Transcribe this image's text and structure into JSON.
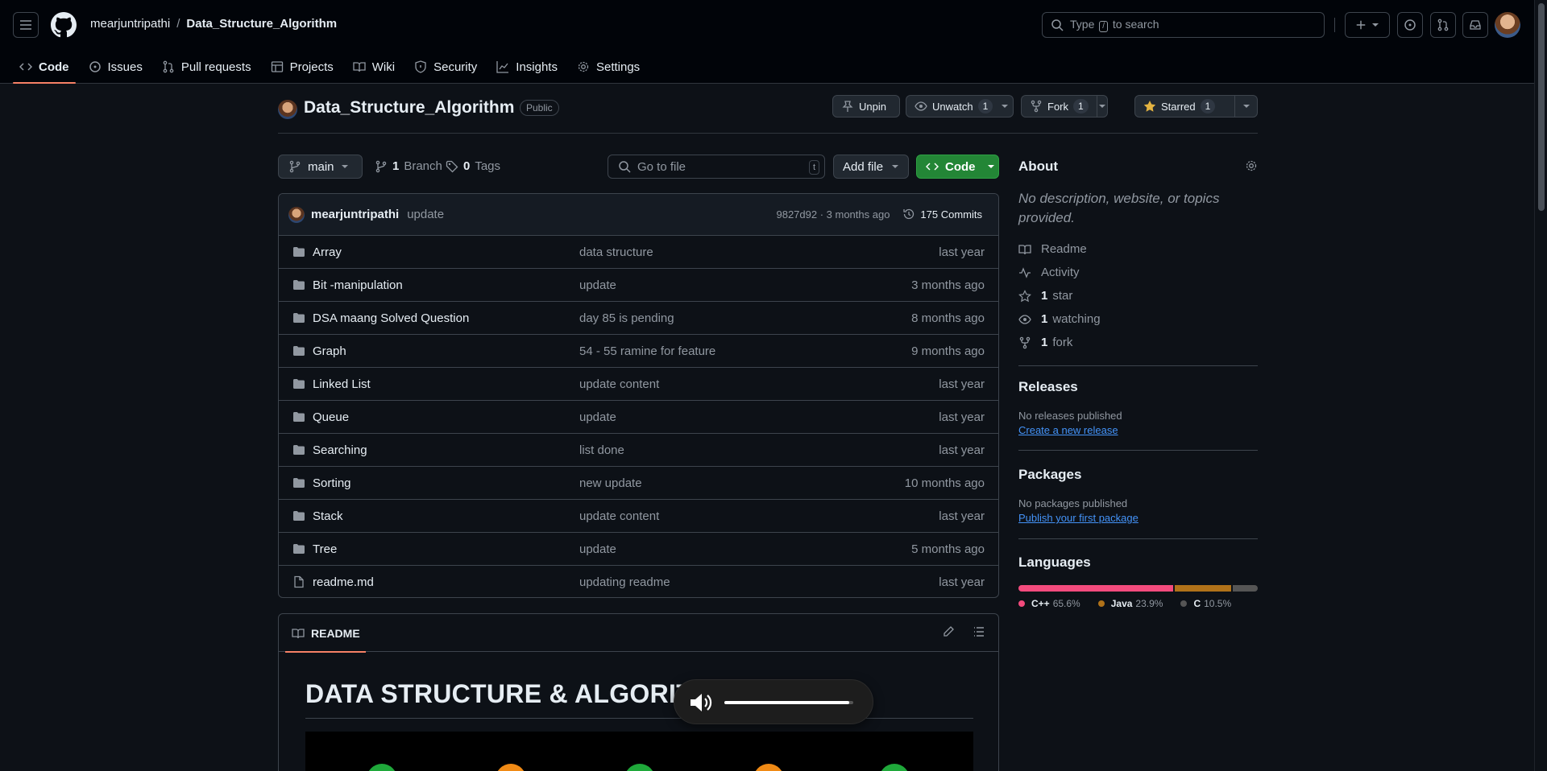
{
  "header": {
    "owner": "mearjuntripathi",
    "slash": "/",
    "repo": "Data_Structure_Algorithm",
    "search_prefix": "Type",
    "search_key": "/",
    "search_suffix": "to search"
  },
  "tabs": [
    {
      "label": "Code",
      "icon": "code-icon"
    },
    {
      "label": "Issues",
      "icon": "issue-icon"
    },
    {
      "label": "Pull requests",
      "icon": "pull-request-icon"
    },
    {
      "label": "Projects",
      "icon": "table-icon"
    },
    {
      "label": "Wiki",
      "icon": "book-icon"
    },
    {
      "label": "Security",
      "icon": "shield-icon"
    },
    {
      "label": "Insights",
      "icon": "graph-icon"
    },
    {
      "label": "Settings",
      "icon": "gear-icon"
    }
  ],
  "repo_header": {
    "title": "Data_Structure_Algorithm",
    "visibility": "Public",
    "unpin": "Unpin",
    "unwatch": "Unwatch",
    "watch_count": "1",
    "fork": "Fork",
    "fork_count": "1",
    "starred": "Starred",
    "star_count": "1"
  },
  "branch": {
    "name": "main",
    "branch_count": "1",
    "branch_label": "Branch",
    "tag_count": "0",
    "tag_label": "Tags",
    "goto_placeholder": "Go to file",
    "goto_key": "t",
    "add_file": "Add file",
    "code": "Code"
  },
  "commit": {
    "user": "mearjuntripathi",
    "message": "update",
    "meta": "9827d92 · 3 months ago",
    "commits": "175 Commits"
  },
  "files": [
    {
      "type": "dir",
      "name": "Array",
      "msg": "data structure",
      "age": "last year"
    },
    {
      "type": "dir",
      "name": "Bit -manipulation",
      "msg": "update",
      "age": "3 months ago"
    },
    {
      "type": "dir",
      "name": "DSA maang Solved Question",
      "msg": "day 85 is pending",
      "age": "8 months ago"
    },
    {
      "type": "dir",
      "name": "Graph",
      "msg": "54 - 55 ramine for feature",
      "age": "9 months ago"
    },
    {
      "type": "dir",
      "name": "Linked List",
      "msg": "update content",
      "age": "last year"
    },
    {
      "type": "dir",
      "name": "Queue",
      "msg": "update",
      "age": "last year"
    },
    {
      "type": "dir",
      "name": "Searching",
      "msg": "list done",
      "age": "last year"
    },
    {
      "type": "dir",
      "name": "Sorting",
      "msg": "new update",
      "age": "10 months ago"
    },
    {
      "type": "dir",
      "name": "Stack",
      "msg": "update content",
      "age": "last year"
    },
    {
      "type": "dir",
      "name": "Tree",
      "msg": "update",
      "age": "5 months ago"
    },
    {
      "type": "file",
      "name": "readme.md",
      "msg": "updating readme",
      "age": "last year"
    }
  ],
  "readme": {
    "tab": "README",
    "title": "DATA STRUCTURE & ALGORITH"
  },
  "about": {
    "heading": "About",
    "description": "No description, website, or topics provided.",
    "readme": "Readme",
    "activity": "Activity",
    "stars_n": "1",
    "stars": "star",
    "watching_n": "1",
    "watching": "watching",
    "forks_n": "1",
    "forks": "fork"
  },
  "releases": {
    "heading": "Releases",
    "none": "No releases published",
    "create": "Create a new release"
  },
  "packages": {
    "heading": "Packages",
    "none": "No packages published",
    "publish": "Publish your first package"
  },
  "languages": {
    "heading": "Languages",
    "items": [
      {
        "name": "C++",
        "pct": "65.6%",
        "value": 65.6,
        "color": "#f34b7d"
      },
      {
        "name": "Java",
        "pct": "23.9%",
        "value": 23.9,
        "color": "#b07219"
      },
      {
        "name": "C",
        "pct": "10.5%",
        "value": 10.5,
        "color": "#555555"
      }
    ]
  },
  "volume": {
    "level": 0.97
  },
  "colors": {
    "accent_green": "#238636",
    "tab_underline": "#f78166",
    "link": "#4493f8"
  }
}
